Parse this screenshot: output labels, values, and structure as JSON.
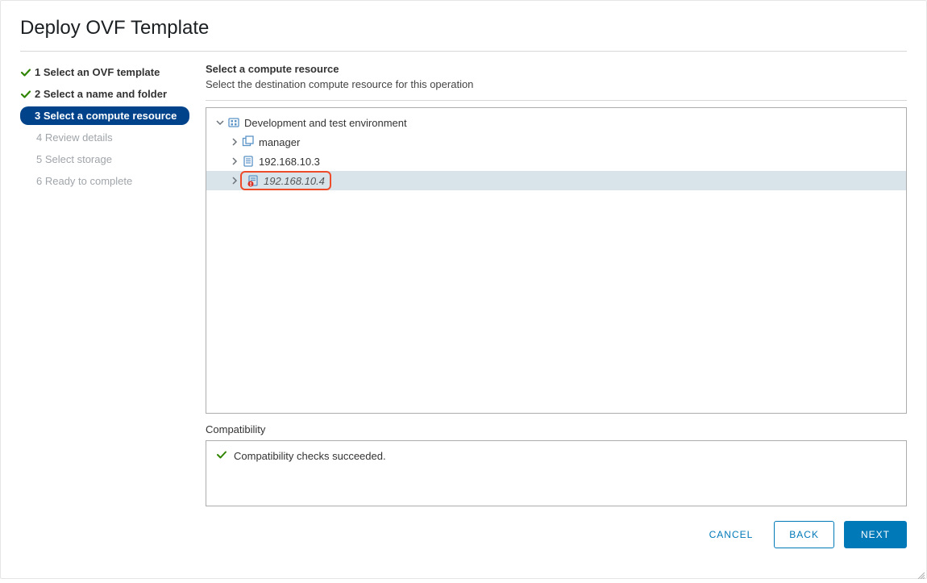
{
  "dialog": {
    "title": "Deploy OVF Template"
  },
  "steps": [
    {
      "label": "1 Select an OVF template",
      "state": "completed"
    },
    {
      "label": "2 Select a name and folder",
      "state": "completed"
    },
    {
      "label": "3 Select a compute resource",
      "state": "current"
    },
    {
      "label": "4 Review details",
      "state": "future"
    },
    {
      "label": "5 Select storage",
      "state": "future"
    },
    {
      "label": "6 Ready to complete",
      "state": "future"
    }
  ],
  "main": {
    "heading": "Select a compute resource",
    "subheading": "Select the destination compute resource for this operation"
  },
  "tree": {
    "root": {
      "label": "Development and test environment",
      "expanded": true
    },
    "children": [
      {
        "label": "manager",
        "icon": "cluster"
      },
      {
        "label": "192.168.10.3",
        "icon": "host"
      },
      {
        "label": "192.168.10.4",
        "icon": "host-error",
        "selected": true,
        "highlighted": true
      }
    ]
  },
  "compatibility": {
    "label": "Compatibility",
    "message": "Compatibility checks succeeded."
  },
  "footer": {
    "cancel": "CANCEL",
    "back": "BACK",
    "next": "NEXT"
  },
  "colors": {
    "primary_blue": "#0079b8",
    "nav_selected": "#00438b",
    "check_green": "#2f8400",
    "highlight_red": "#ee4b2b"
  }
}
